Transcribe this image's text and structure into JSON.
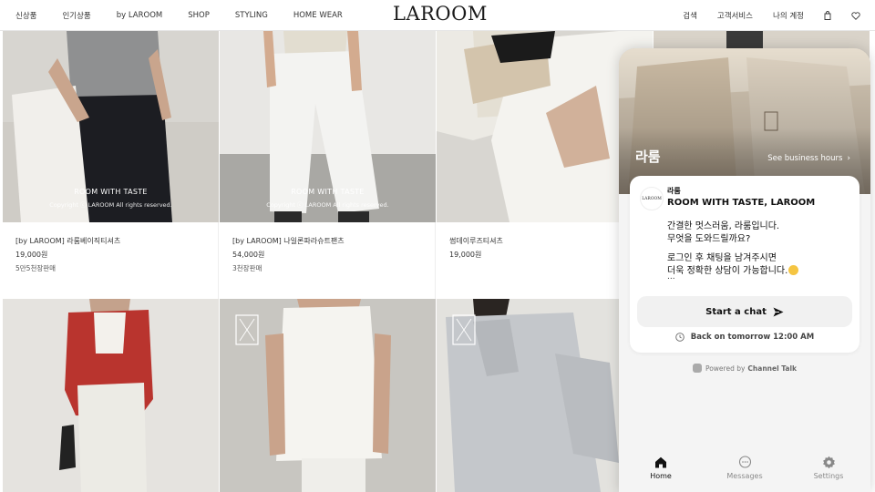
{
  "header": {
    "nav_left": [
      "신상품",
      "인기상품",
      "by LAROOM",
      "SHOP",
      "STYLING",
      "HOME WEAR"
    ],
    "logo": "LAROOM",
    "nav_right": [
      "검색",
      "고객서비스",
      "나의 계정"
    ],
    "icons": [
      "bag-icon",
      "heart-icon"
    ]
  },
  "products": [
    {
      "name": "[by LAROOM] 라룸베이직티셔츠",
      "price": "19,000원",
      "sold": "5만5천장판매",
      "watermark_title": "ROOM WITH TASTE",
      "watermark_copy": "Copyright ⓒ LAROOM All rights reserved."
    },
    {
      "name": "[by LAROOM] 나일론파라슈트팬츠",
      "price": "54,000원",
      "sold": "3천장판매",
      "watermark_title": "ROOM WITH TASTE",
      "watermark_copy": "Copyright ⓒ LAROOM All rights reserved."
    },
    {
      "name": "썸데이루즈티셔츠",
      "price": "19,000원",
      "sold": ""
    }
  ],
  "chat": {
    "brand": "라룸",
    "hours_link": "See business hours",
    "sender": "라룸",
    "avatar_text": "LAROOM",
    "message_title": "ROOM WITH TASTE, LAROOM",
    "message_lines": [
      "간결한 멋스러움, 라룸입니다.",
      "무엇을 도와드릴까요?",
      "로그인 후 채팅을 남겨주시면",
      "더욱 정확한 상담이 가능합니다."
    ],
    "ellipsis": "...",
    "start_button": "Start a chat",
    "back_text": "Back on tomorrow 12:00 AM",
    "powered_prefix": "Powered by",
    "powered_brand": "Channel Talk",
    "tabs": [
      {
        "label": "Home",
        "icon": "home-icon",
        "active": true
      },
      {
        "label": "Messages",
        "icon": "messages-icon",
        "active": false
      },
      {
        "label": "Settings",
        "icon": "settings-icon",
        "active": false
      }
    ]
  },
  "colors": {
    "accent": "#111111",
    "chat_bg": "#f4f4f4",
    "button_bg": "#f1f1f1"
  }
}
